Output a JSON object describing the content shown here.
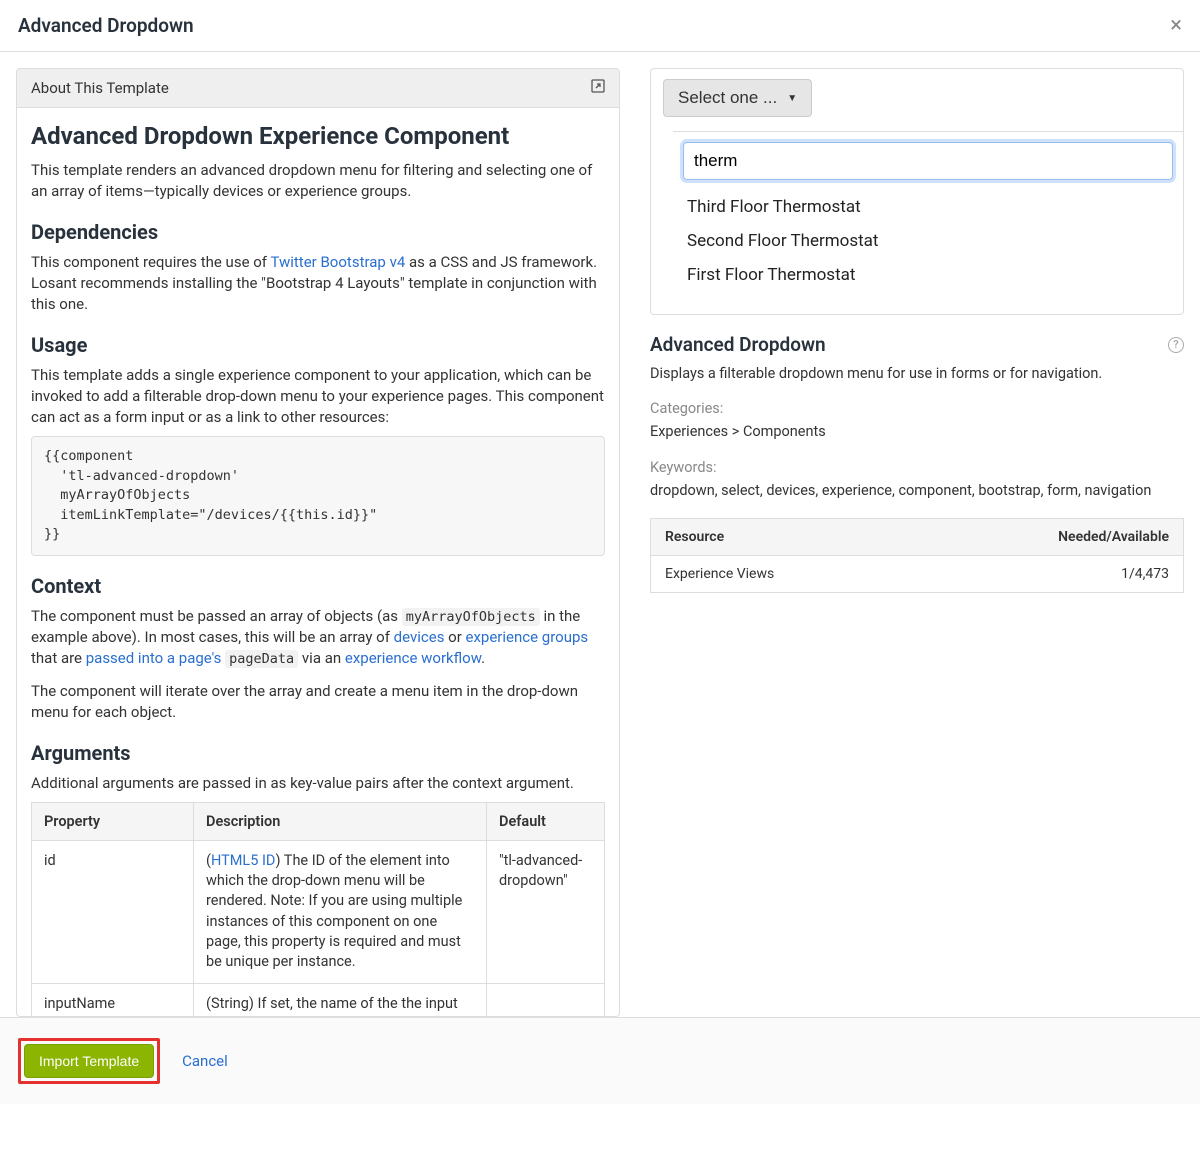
{
  "header": {
    "title": "Advanced Dropdown"
  },
  "about": {
    "panel_title": "About This Template",
    "h1": "Advanced Dropdown Experience Component",
    "intro": "This template renders an advanced dropdown menu for filtering and selecting one of an array of items—typically devices or experience groups.",
    "deps_h": "Dependencies",
    "deps_p1a": "This component requires the use of ",
    "deps_link": "Twitter Bootstrap v4",
    "deps_p1b": " as a CSS and JS framework. Losant recommends installing the \"Bootstrap 4 Layouts\" template in conjunction with this one.",
    "usage_h": "Usage",
    "usage_p": "This template adds a single experience component to your application, which can be invoked to add a filterable drop-down menu to your experience pages. This component can act as a form input or as a link to other resources:",
    "code": "{{component\n  'tl-advanced-dropdown'\n  myArrayOfObjects\n  itemLinkTemplate=\"/devices/{{this.id}}\"\n}}",
    "context_h": "Context",
    "ctx_a": "The component must be passed an array of objects (as ",
    "ctx_code1": "myArrayOfObjects",
    "ctx_b": " in the example above). In most cases, this will be an array of ",
    "ctx_l1": "devices",
    "ctx_c": " or ",
    "ctx_l2": "experience groups",
    "ctx_d": " that are ",
    "ctx_l3": "passed into a page's",
    "ctx_code2": "pageData",
    "ctx_e": " via an ",
    "ctx_l4": "experience workflow",
    "ctx_f": ".",
    "ctx_p2": "The component will iterate over the array and create a menu item in the drop-down menu for each object.",
    "args_h": "Arguments",
    "args_p": "Additional arguments are passed in as key-value pairs after the context argument.",
    "table": {
      "th1": "Property",
      "th2": "Description",
      "th3": "Default",
      "r1c1": "id",
      "r1_link": "HTML5 ID",
      "r1c2a": "(",
      "r1c2b": ") The ID of the element into which the drop-down menu will be rendered. Note: If you are using multiple instances of this component on one page, this property is required and must be unique per instance.",
      "r1c3": "\"tl-advanced-dropdown\"",
      "r2c1": "inputName",
      "r2c2": "(String) If set, the name of the the input whose value should be associated with the selected menu item.",
      "r2c3": ""
    }
  },
  "preview": {
    "select_label": "Select one ...",
    "filter_value": "therm",
    "items": [
      "Third Floor Thermostat",
      "Second Floor Thermostat",
      "First Floor Thermostat"
    ]
  },
  "sidebar": {
    "title": "Advanced Dropdown",
    "desc": "Displays a filterable dropdown menu for use in forms or for navigation.",
    "cat_label": "Categories:",
    "cat_value": "Experiences > Components",
    "kw_label": "Keywords:",
    "kw_value": "dropdown, select, devices, experience, component, bootstrap, form, navigation",
    "res_th1": "Resource",
    "res_th2": "Needed/Available",
    "res_r1": "Experience Views",
    "res_r1v": "1/4,473"
  },
  "footer": {
    "import": "Import Template",
    "cancel": "Cancel"
  }
}
